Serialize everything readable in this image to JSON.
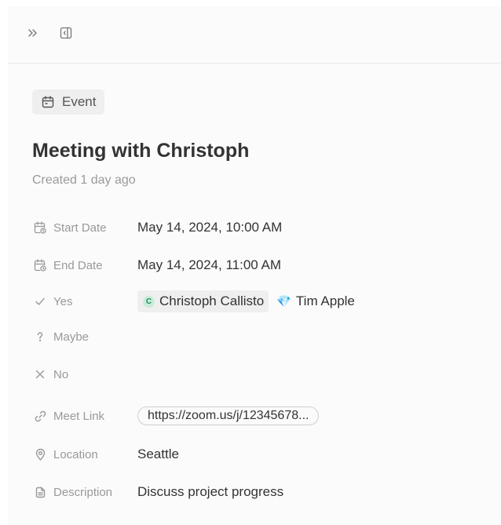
{
  "toolbar": {
    "expand_icon": "chevrons-right-icon",
    "panel_icon": "sidebar-panel-icon"
  },
  "record": {
    "type_label": "Event",
    "type_icon": "calendar-icon",
    "title": "Meeting with Christoph",
    "created": "Created 1 day ago"
  },
  "fields": {
    "start_date": {
      "label": "Start Date",
      "value": "May 14, 2024, 10:00 AM",
      "icon": "calendar-clock-icon"
    },
    "end_date": {
      "label": "End Date",
      "value": "May 14, 2024, 11:00 AM",
      "icon": "calendar-clock-icon"
    },
    "yes": {
      "label": "Yes",
      "icon": "check-icon",
      "people": [
        {
          "name": "Christoph Callisto",
          "initial": "C"
        },
        {
          "name": "Tim Apple",
          "emoji": "💎"
        }
      ]
    },
    "maybe": {
      "label": "Maybe",
      "icon": "question-icon"
    },
    "no": {
      "label": "No",
      "icon": "x-icon"
    },
    "meet_link": {
      "label": "Meet Link",
      "value": "https://zoom.us/j/12345678...",
      "icon": "link-icon"
    },
    "location": {
      "label": "Location",
      "value": "Seattle",
      "icon": "map-pin-icon"
    },
    "description": {
      "label": "Description",
      "value": "Discuss project progress",
      "icon": "document-icon"
    }
  },
  "colors": {
    "background": "#fbfbfb",
    "chip": "#efefef",
    "avatar_bg": "#c8ecd9",
    "avatar_fg": "#1d8f5a",
    "label": "#999999"
  }
}
